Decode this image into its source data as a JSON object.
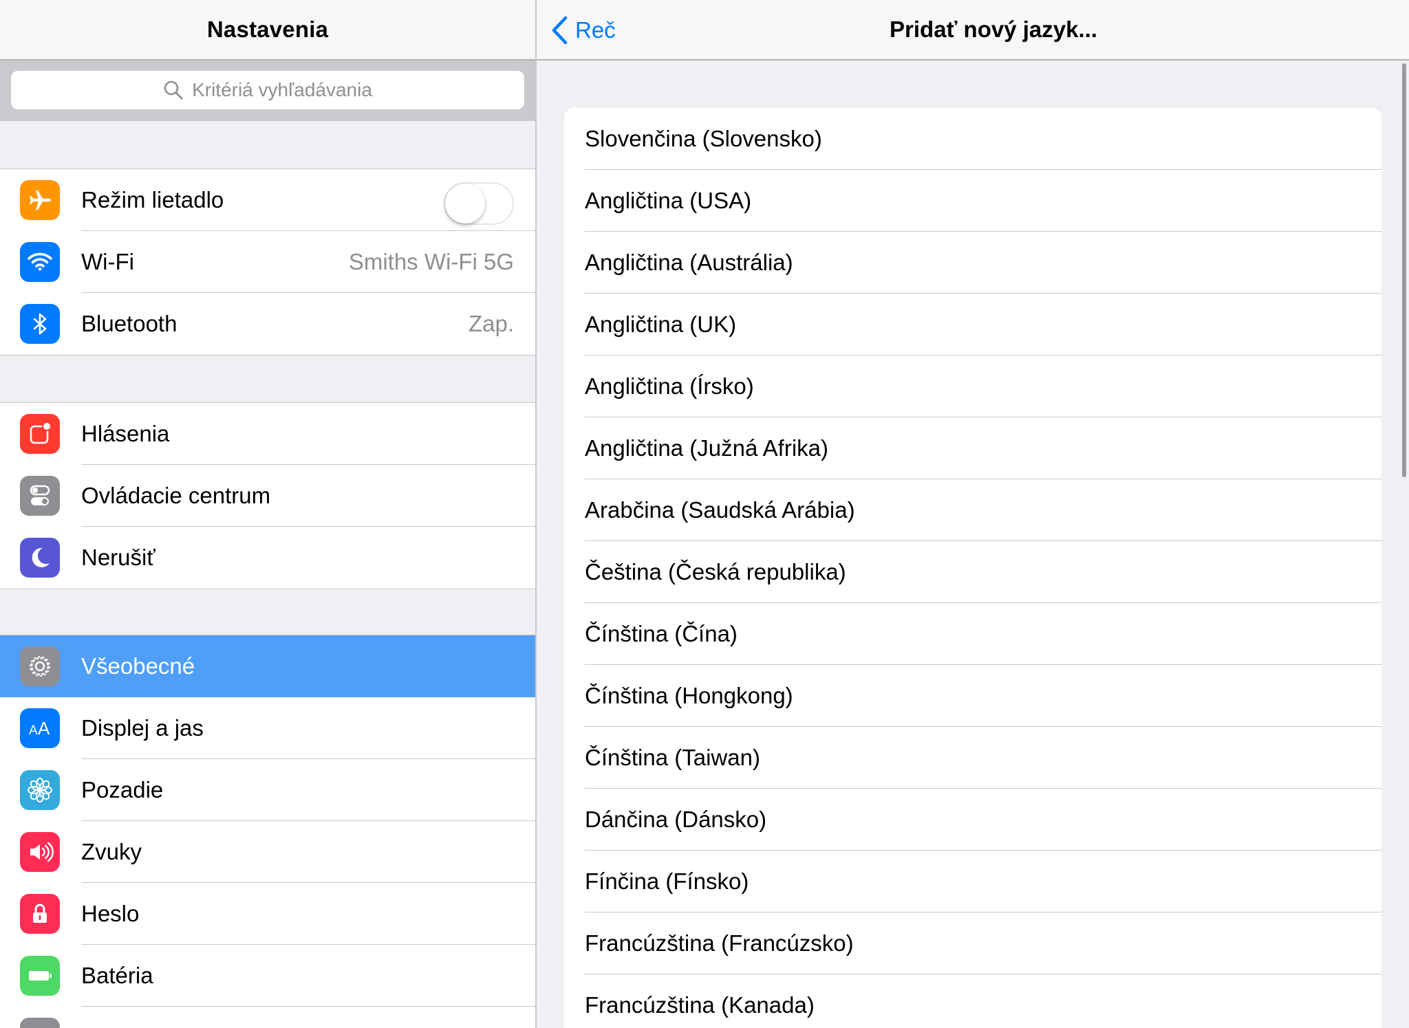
{
  "left": {
    "title": "Nastavenia",
    "search_placeholder": "Kritériá vyhľadávania",
    "group1": [
      {
        "label": "Režim lietadlo",
        "icon": "airplane-icon",
        "color": "#ff9500",
        "toggle": false
      },
      {
        "label": "Wi-Fi",
        "icon": "wifi-icon",
        "color": "#007aff",
        "value": "Smiths Wi-Fi 5G"
      },
      {
        "label": "Bluetooth",
        "icon": "bluetooth-icon",
        "color": "#007aff",
        "value": "Zap."
      }
    ],
    "group2": [
      {
        "label": "Hlásenia",
        "icon": "notifications-icon",
        "color": "#ff3b30"
      },
      {
        "label": "Ovládacie centrum",
        "icon": "control-center-icon",
        "color": "#8e8e93"
      },
      {
        "label": "Nerušiť",
        "icon": "moon-icon",
        "color": "#5856d6"
      }
    ],
    "group3": [
      {
        "label": "Všeobecné",
        "icon": "gear-icon",
        "color": "#8e8e93",
        "selected": true
      },
      {
        "label": "Displej a jas",
        "icon": "text-size-icon",
        "color": "#007aff"
      },
      {
        "label": "Pozadie",
        "icon": "wallpaper-flower-icon",
        "color": "#34aadc"
      },
      {
        "label": "Zvuky",
        "icon": "speaker-icon",
        "color": "#ff2d55"
      },
      {
        "label": "Heslo",
        "icon": "lock-icon",
        "color": "#ff2d55"
      },
      {
        "label": "Batéria",
        "icon": "battery-icon",
        "color": "#4cd964"
      }
    ]
  },
  "right": {
    "back_label": "Reč",
    "title": "Pridať nový jazyk...",
    "languages": [
      "Slovenčina (Slovensko)",
      "Angličtina (USA)",
      "Angličtina (Austrália)",
      "Angličtina (UK)",
      "Angličtina (Írsko)",
      "Angličtina (Južná Afrika)",
      "Arabčina (Saudská Arábia)",
      "Čeština (Česká republika)",
      "Čínština (Čína)",
      "Čínština (Hongkong)",
      "Čínština (Taiwan)",
      "Dánčina (Dánsko)",
      "Fínčina (Fínsko)",
      "Francúzština (Francúzsko)",
      "Francúzština (Kanada)"
    ]
  }
}
